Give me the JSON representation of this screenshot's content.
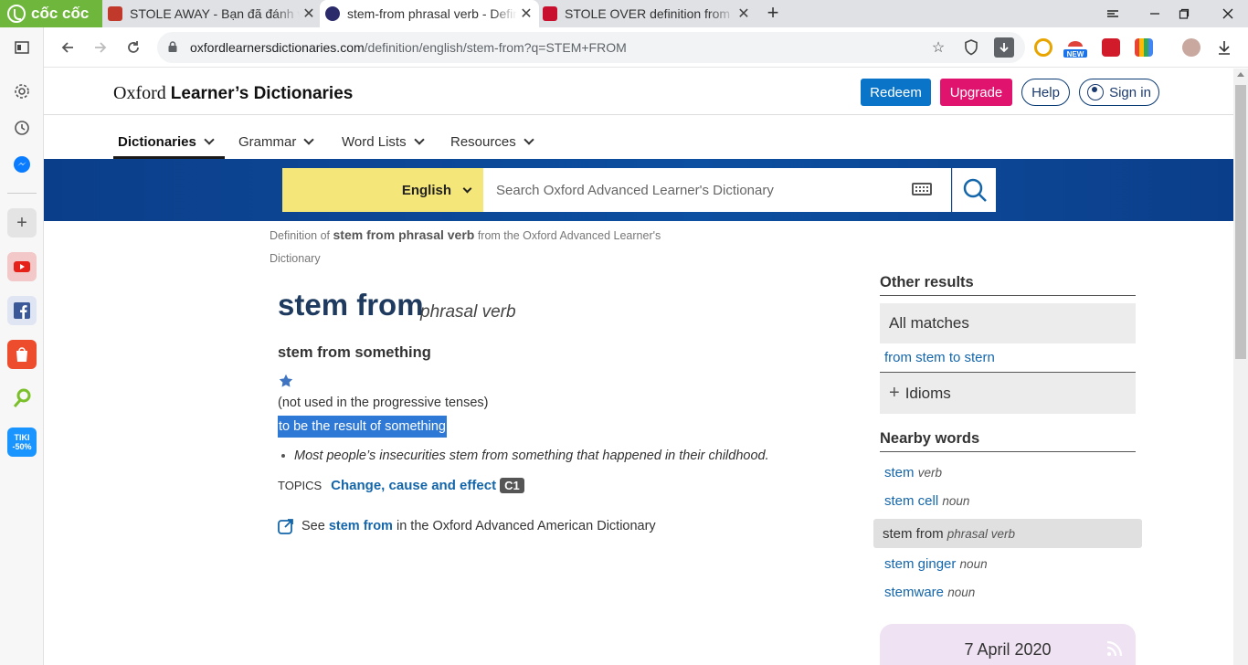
{
  "browser": {
    "brand": "cốc cốc",
    "tabs": [
      {
        "title": "STOLE AWAY - Bạn đã đánh vần",
        "fav_color": "#c0392b"
      },
      {
        "title": "stem-from phrasal verb - Defini",
        "fav_color": "#2b2a6b"
      },
      {
        "title": "STOLE OVER definition from Mac",
        "fav_color": "#c8102e"
      }
    ],
    "url_host": "oxfordlearnersdictionaries.com",
    "url_path": "/definition/english/stem-from?q=STEM+FROM"
  },
  "site": {
    "title_a": "Oxford",
    "title_b": "Learner’s Dictionaries",
    "redeem": "Redeem",
    "upgrade": "Upgrade",
    "help": "Help",
    "signin": "Sign in",
    "nav": [
      "Dictionaries",
      "Grammar",
      "Word Lists",
      "Resources"
    ],
    "language": "English",
    "search_placeholder": "Search Oxford Advanced Learner's Dictionary"
  },
  "entry": {
    "breadcrumb_pre": "Definition of",
    "breadcrumb_word": "stem from phrasal verb",
    "breadcrumb_post": "from the Oxford Advanced Learner's Dictionary",
    "headword": "stem from",
    "pos": "phrasal verb",
    "phrase": "stem from something",
    "grammar_note": "(not used in the progressive tenses)",
    "definition": "to be the result of something",
    "example": "Most people’s insecurities stem from something that happened in their childhood.",
    "topics_label": "TOPICS",
    "topic": "Change, cause and effect",
    "level": "C1",
    "see_pre": "See",
    "see_word": "stem from",
    "see_post": "in the Oxford Advanced American Dictionary"
  },
  "sidebar_right": {
    "other_results": "Other results",
    "all_matches": "All matches",
    "match_link": "from stem to stern",
    "idioms": "Idioms",
    "nearby_title": "Nearby words",
    "nearby": [
      {
        "word": "stem",
        "pos": "verb"
      },
      {
        "word": "stem cell",
        "pos": "noun"
      },
      {
        "word": "stem from",
        "pos": "phrasal verb"
      },
      {
        "word": "stem ginger",
        "pos": "noun"
      },
      {
        "word": "stemware",
        "pos": "noun"
      }
    ],
    "wotd_date": "7 April 2020"
  },
  "colors": {
    "band": "#0d4fa0",
    "lang_bg": "#f5e67a",
    "redeem": "#0a74c8",
    "upgrade": "#e0136f",
    "highlight": "#2f79d6",
    "link": "#1466ab",
    "headword": "#1e3a5f"
  }
}
